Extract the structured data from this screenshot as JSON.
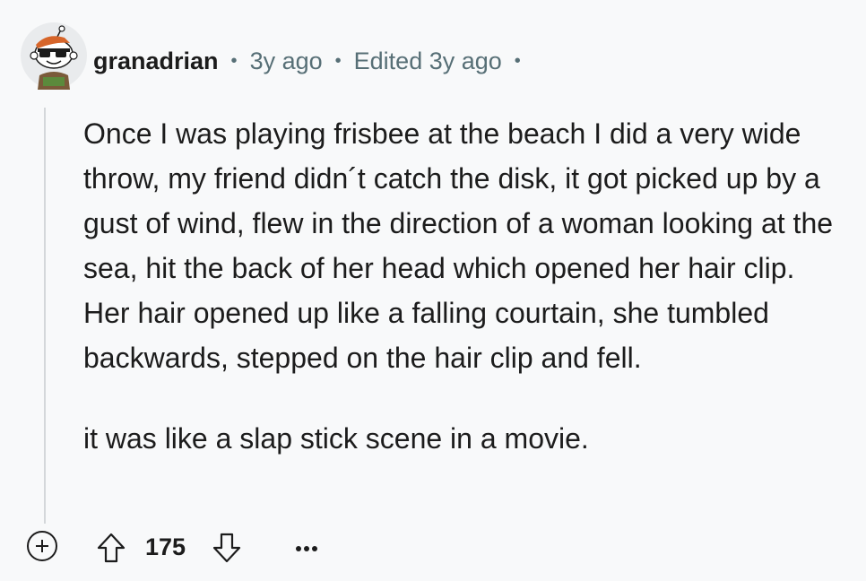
{
  "comment": {
    "username": "granadrian",
    "age": "3y ago",
    "edited": "Edited 3y ago",
    "separator": "•",
    "paragraphs": [
      "Once I was playing frisbee at the beach I did a very wide throw, my friend didn´t catch the disk, it got picked up by a gust of wind, flew in the direction of a woman looking at the sea, hit the back of her head which opened her hair clip. Her hair opened up like a falling courtain, she tumbled backwards, stepped on the hair clip and fell.",
      "it was like a slap stick scene in a movie."
    ],
    "score": "175"
  },
  "icons": {
    "avatar": "snoo-avatar-sunglasses",
    "expand": "plus-circle-icon",
    "upvote": "arrow-up-outline-icon",
    "downvote": "arrow-down-outline-icon",
    "more": "overflow-dots-icon"
  },
  "colors": {
    "background": "#f8f9fa",
    "text": "#1c1c1c",
    "meta": "#576f76",
    "thread_line": "#d4d7da"
  }
}
